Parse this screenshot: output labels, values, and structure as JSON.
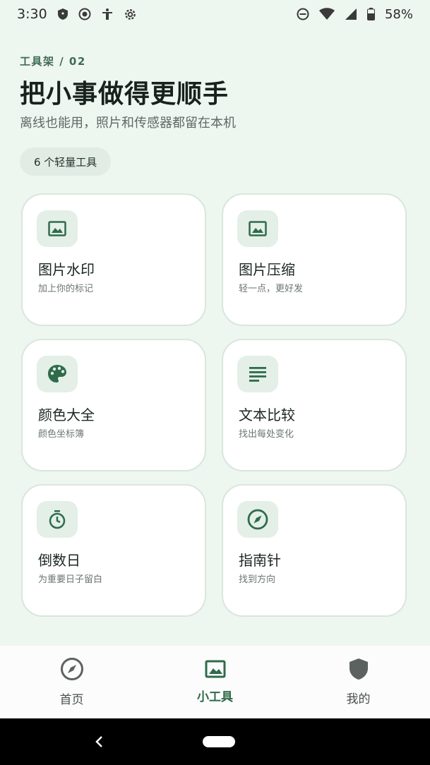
{
  "status_bar": {
    "time": "3:30",
    "battery": "58%",
    "left_icons": [
      "shield-icon",
      "record-icon",
      "accessibility-icon",
      "gear-icon"
    ],
    "right_icons": [
      "dnd-icon",
      "wifi-icon",
      "signal-icon",
      "battery-icon"
    ]
  },
  "header": {
    "eyebrow": "工具架 / 02",
    "title": "把小事做得更顺手",
    "subtitle": "离线也能用，照片和传感器都留在本机",
    "tool_count": "6 个轻量工具"
  },
  "tools": [
    {
      "title": "图片水印",
      "desc": "加上你的标记",
      "icon": "image-icon"
    },
    {
      "title": "图片压缩",
      "desc": "轻一点，更好发",
      "icon": "image-icon"
    },
    {
      "title": "颜色大全",
      "desc": "颜色坐标簿",
      "icon": "palette-icon"
    },
    {
      "title": "文本比较",
      "desc": "找出每处变化",
      "icon": "text-lines-icon"
    },
    {
      "title": "倒数日",
      "desc": "为重要日子留白",
      "icon": "timer-icon"
    },
    {
      "title": "指南针",
      "desc": "找到方向",
      "icon": "compass-icon"
    }
  ],
  "bottom_nav": {
    "items": [
      {
        "label": "首页",
        "icon": "compass-icon",
        "active": false
      },
      {
        "label": "小工具",
        "icon": "image-icon",
        "active": true
      },
      {
        "label": "我的",
        "icon": "shield-icon",
        "active": false
      }
    ]
  },
  "colors": {
    "background": "#eef6f0",
    "accent": "#2f6b4b",
    "card_border": "#d9e6dd",
    "icon_tile": "#e3efe7"
  }
}
